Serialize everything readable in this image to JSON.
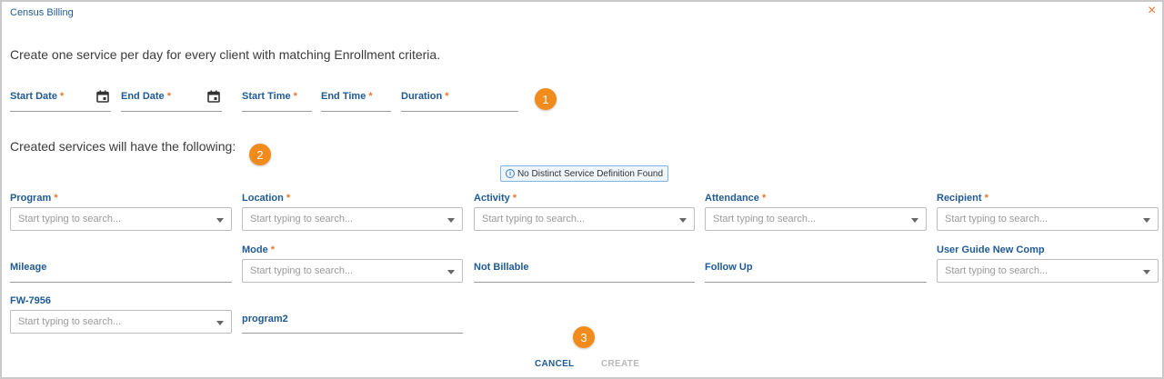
{
  "dialog": {
    "title": "Census Billing",
    "close_label": "×",
    "instruction": "Create one service per day for every client with matching Enrollment criteria.",
    "subheading": "Created services will have the following:"
  },
  "date_fields": {
    "start_date": {
      "label": "Start Date",
      "required": "*"
    },
    "end_date": {
      "label": "End Date",
      "required": "*"
    },
    "start_time": {
      "label": "Start Time",
      "required": "*"
    },
    "end_time": {
      "label": "End Time",
      "required": "*"
    },
    "duration": {
      "label": "Duration",
      "required": "*"
    }
  },
  "badges": [
    "1",
    "2",
    "3"
  ],
  "notice": {
    "text": "No Distinct Service Definition Found",
    "icon": "info-icon"
  },
  "placeholder": "Start typing to search...",
  "fields": {
    "program": {
      "label": "Program",
      "required": "*"
    },
    "location": {
      "label": "Location",
      "required": "*"
    },
    "activity": {
      "label": "Activity",
      "required": "*"
    },
    "attendance": {
      "label": "Attendance",
      "required": "*"
    },
    "recipient": {
      "label": "Recipient",
      "required": "*"
    },
    "mileage": {
      "label": "Mileage"
    },
    "mode": {
      "label": "Mode",
      "required": "*"
    },
    "not_billable": {
      "label": "Not Billable"
    },
    "follow_up": {
      "label": "Follow Up"
    },
    "user_guide": {
      "label": "User Guide New Comp"
    },
    "fw7956": {
      "label": "FW-7956"
    },
    "program2": {
      "label": "program2"
    }
  },
  "actions": {
    "cancel": "CANCEL",
    "create": "CREATE"
  },
  "colors": {
    "accent": "#1f5a94",
    "required": "#e8772e",
    "badge": "#f08b1c",
    "disabled": "#b8b8b8"
  }
}
